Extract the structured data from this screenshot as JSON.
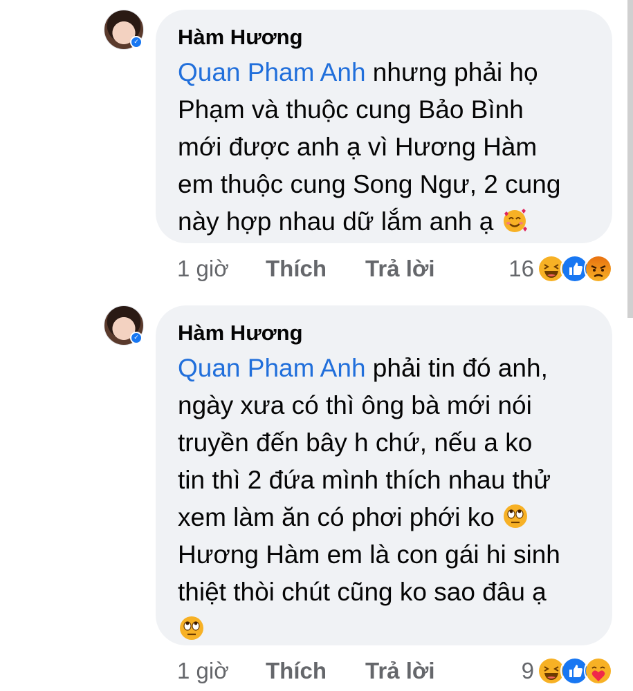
{
  "comments": [
    {
      "author": "Hàm Hương",
      "mention": "Quan Pham Anh",
      "lines": [
        " nhưng phải họ",
        "Phạm và thuộc cung Bảo Bình",
        "mới được anh ạ vì Hương Hàm",
        "em thuộc cung Song Ngư, 2 cung",
        "này hợp nhau dữ lắm anh ạ"
      ],
      "trailing_emoji": "smiling-face-with-hearts-emoji",
      "time": "1 giờ",
      "like_label": "Thích",
      "reply_label": "Trả lời",
      "reaction_count": "16",
      "reactions": [
        "haha-reaction-icon",
        "like-reaction-icon",
        "angry-reaction-icon"
      ]
    },
    {
      "author": "Hàm Hương",
      "mention": "Quan Pham Anh",
      "lines": [
        " phải tin đó anh,",
        "ngày xưa có thì ông bà mới nói",
        "truyền đến bây h chứ, nếu a ko",
        "tin thì 2 đứa mình thích nhau thử",
        "xem làm ăn có phơi phới ko",
        "Hương Hàm em là con gái hi sinh",
        "thiệt thòi chút cũng ko sao đâu ạ"
      ],
      "inline_emoji": "eye-roll-emoji",
      "trailing_emoji": "eye-roll-emoji",
      "time": "1 giờ",
      "like_label": "Thích",
      "reply_label": "Trả lời",
      "reaction_count": "9",
      "reactions": [
        "haha-reaction-icon",
        "like-reaction-icon",
        "care-reaction-icon"
      ]
    }
  ],
  "colors": {
    "bubble": "#f0f2f5",
    "mention": "#216fdb",
    "meta": "#65676b",
    "like_blue": "#1877f2",
    "haha_yellow": "#f7b125",
    "angry_orange": "#e9710f"
  }
}
